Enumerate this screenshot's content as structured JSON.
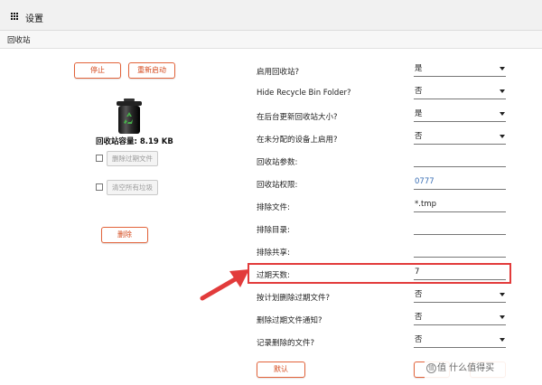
{
  "window": {
    "title": "设置"
  },
  "breadcrumb": "回收站",
  "left": {
    "stop_label": "停止",
    "restart_label": "重新启动",
    "capacity_text": "回收站容量: 8.19 KB",
    "delete_expired_label": "删除过期文件",
    "empty_all_label": "清空所有垃圾",
    "delete_label": "删除"
  },
  "settings": [
    {
      "label": "启用回收站?",
      "value": "是",
      "type": "select"
    },
    {
      "label": "Hide Recycle Bin Folder?",
      "value": "否",
      "type": "select"
    },
    {
      "label": "在后台更新回收站大小?",
      "value": "是",
      "type": "select"
    },
    {
      "label": "在未分配的设备上启用?",
      "value": "否",
      "type": "select"
    },
    {
      "label": "回收站参数:",
      "value": "",
      "type": "input"
    },
    {
      "label": "回收站权限:",
      "value": "0777",
      "type": "input"
    },
    {
      "label": "排除文件:",
      "value": "*.tmp",
      "type": "input"
    },
    {
      "label": "排除目录:",
      "value": "",
      "type": "input"
    },
    {
      "label": "排除共享:",
      "value": "",
      "type": "input"
    },
    {
      "label": "过期天数:",
      "value": "7",
      "type": "input"
    },
    {
      "label": "按计划删除过期文件?",
      "value": "否",
      "type": "select"
    },
    {
      "label": "删除过期文件通知?",
      "value": "否",
      "type": "select"
    },
    {
      "label": "记录删除的文件?",
      "value": "否",
      "type": "select"
    }
  ],
  "footer": {
    "default_label": "默认"
  },
  "watermark": {
    "text": "值 什么值得买",
    "icon_glyph": "值"
  },
  "colors": {
    "accent": "#e2633a",
    "highlight": "#e23b3b",
    "link_blue": "#3a6fb5"
  }
}
